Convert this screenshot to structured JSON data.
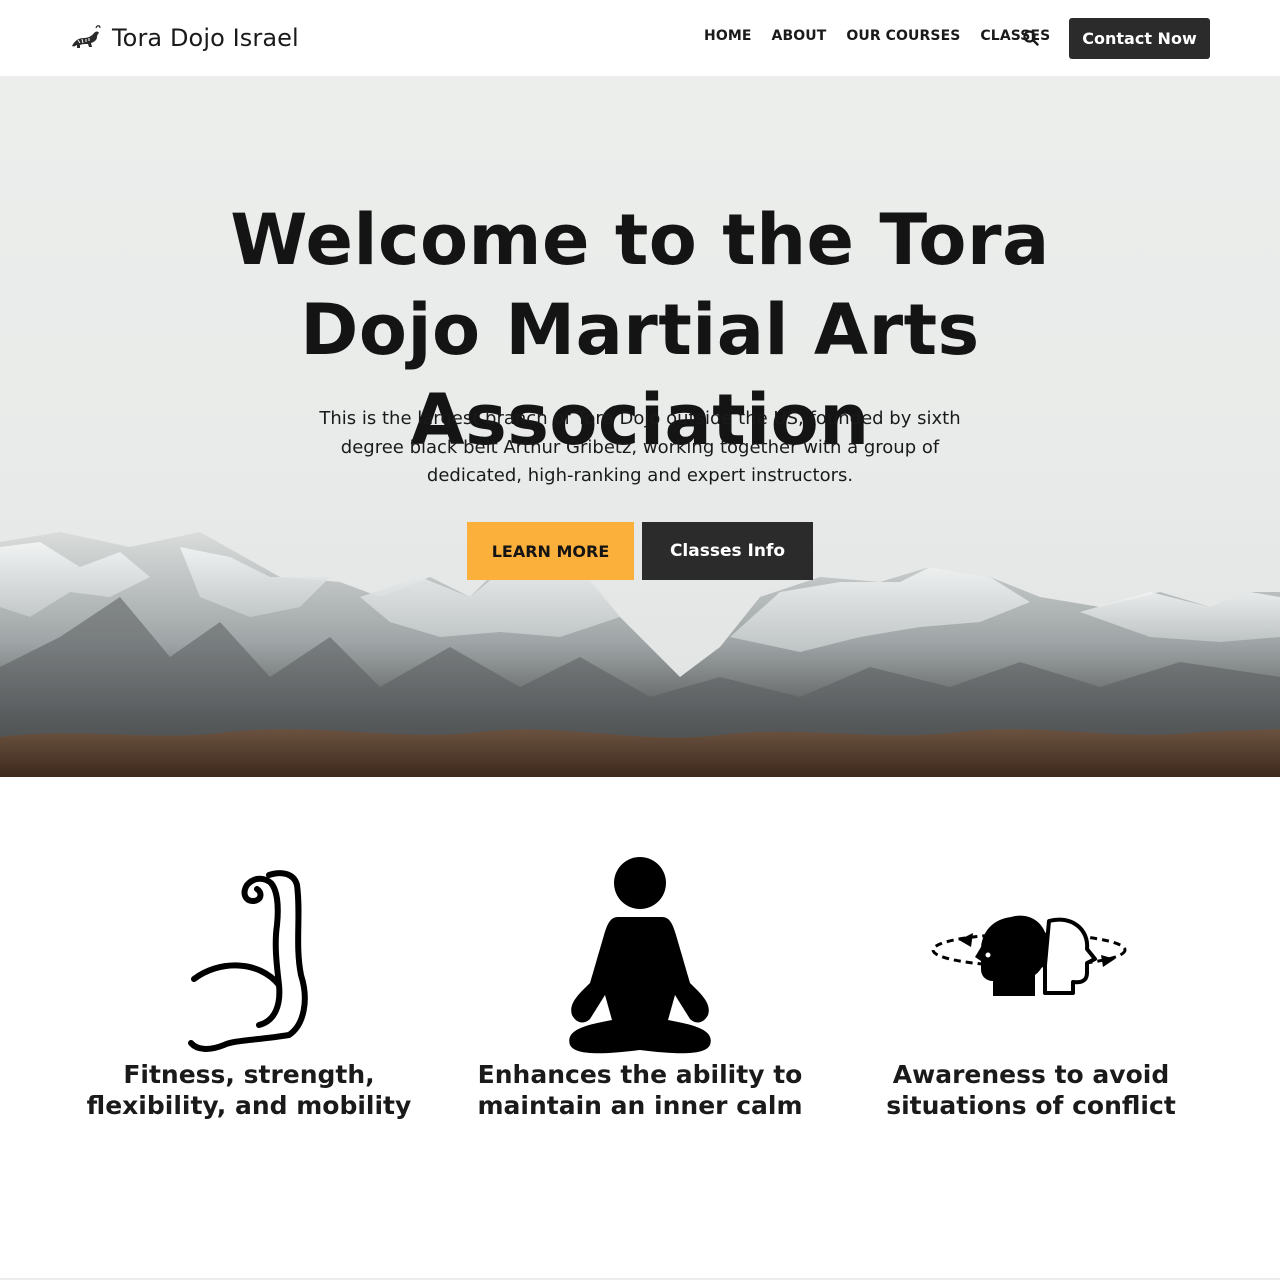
{
  "header": {
    "site_title": "Tora Dojo Israel",
    "logo_icon": "tiger-logo-icon",
    "nav": [
      {
        "label": "HOME"
      },
      {
        "label": "ABOUT"
      },
      {
        "label": "OUR COURSES"
      },
      {
        "label": "CLASSES"
      }
    ],
    "search_icon": "search-icon",
    "contact_label": "Contact Now"
  },
  "hero": {
    "title": "Welcome to the Tora Dojo Martial Arts Association",
    "description": "This is the largest branch of Tora Dojo outside the US, founded by sixth degree black belt Arthur Gribetz, working together with a group of dedicated, high-ranking and expert instructors.",
    "learn_more_label": "LEARN MORE",
    "classes_info_label": "Classes Info",
    "background": "snowy-mountains-image"
  },
  "features": [
    {
      "icon": "flexed-arm-icon",
      "title": "Fitness, strength, flexibility, and mobility"
    },
    {
      "icon": "meditation-icon",
      "title": "Enhances the ability to maintain an inner calm"
    },
    {
      "icon": "awareness-heads-icon",
      "title": "Awareness to avoid situations of conflict"
    }
  ],
  "colors": {
    "accent": "#fbb03b",
    "dark_button": "#2b2b2b",
    "text": "#161616"
  }
}
